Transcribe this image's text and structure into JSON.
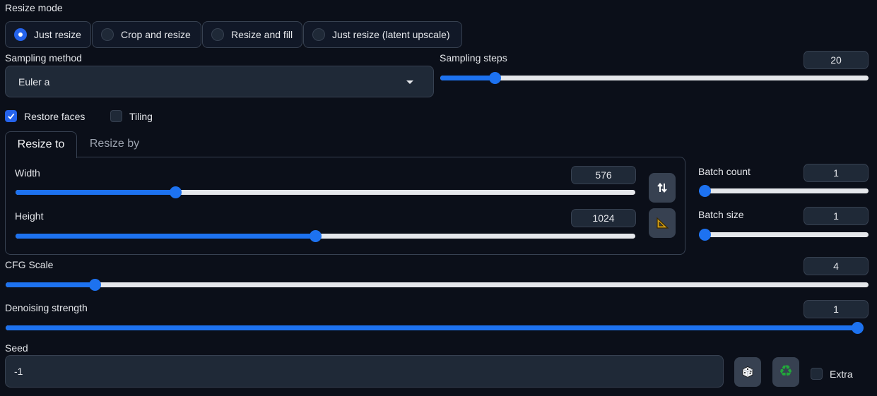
{
  "resize_mode": {
    "label": "Resize mode",
    "options": [
      {
        "label": "Just resize",
        "selected": true
      },
      {
        "label": "Crop and resize",
        "selected": false
      },
      {
        "label": "Resize and fill",
        "selected": false
      },
      {
        "label": "Just resize (latent upscale)",
        "selected": false
      }
    ]
  },
  "sampling_method": {
    "label": "Sampling method",
    "value": "Euler a"
  },
  "sampling_steps": {
    "label": "Sampling steps",
    "value": "20",
    "min": 1,
    "max": 150
  },
  "checkboxes": {
    "restore_faces": {
      "label": "Restore faces",
      "checked": true
    },
    "tiling": {
      "label": "Tiling",
      "checked": false
    }
  },
  "tabs": [
    {
      "label": "Resize to",
      "active": true
    },
    {
      "label": "Resize by",
      "active": false
    }
  ],
  "width": {
    "label": "Width",
    "value": "576",
    "min": 64,
    "max": 2048
  },
  "height": {
    "label": "Height",
    "value": "1024",
    "min": 64,
    "max": 2048
  },
  "buttons": {
    "swap": {
      "icon": "swap-arrows-icon",
      "glyph": "⇅"
    },
    "aspect": {
      "icon": "triangle-ruler-icon",
      "glyph": "📐"
    },
    "random_seed": {
      "icon": "dice-icon",
      "glyph": "🎲"
    },
    "reuse_seed": {
      "icon": "recycle-icon",
      "glyph": "♻"
    }
  },
  "batch_count": {
    "label": "Batch count",
    "value": "1",
    "min": 1,
    "max": 100
  },
  "batch_size": {
    "label": "Batch size",
    "value": "1",
    "min": 1,
    "max": 8
  },
  "cfg_scale": {
    "label": "CFG Scale",
    "value": "4",
    "min": 1,
    "max": 30
  },
  "denoising_strength": {
    "label": "Denoising strength",
    "value": "1",
    "min": 0,
    "max": 1
  },
  "seed": {
    "label": "Seed",
    "value": "-1"
  },
  "extra": {
    "label": "Extra",
    "checked": false
  },
  "colors": {
    "accent": "#1d72f0",
    "background": "#0b0f19",
    "surface": "#1f2937",
    "border": "#374151"
  }
}
